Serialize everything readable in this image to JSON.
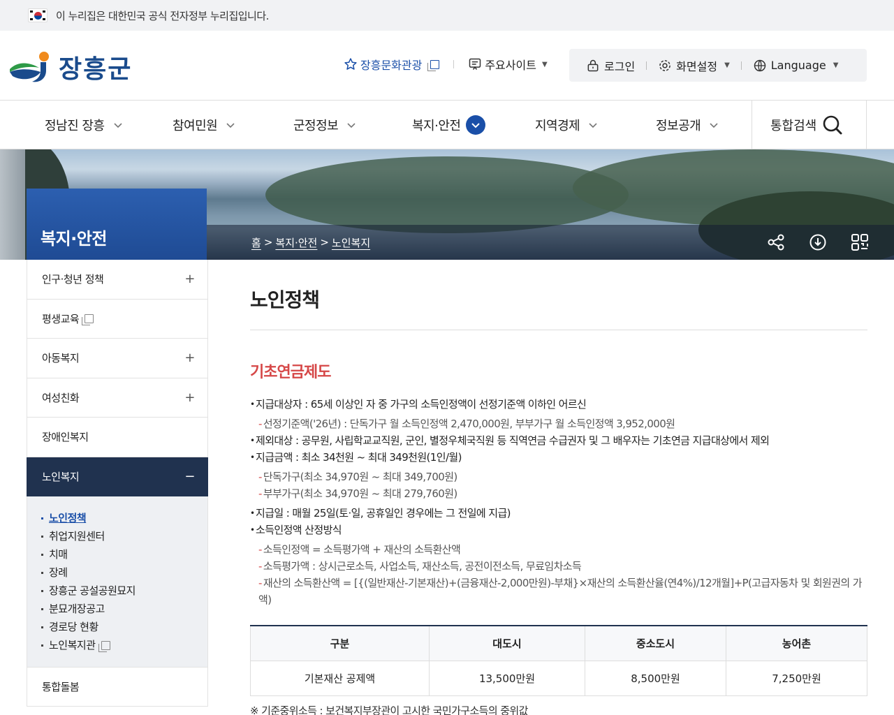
{
  "gov_banner": {
    "text": "이 누리집은 대한민국 공식 전자정부 누리집입니다."
  },
  "header": {
    "logo_text": "장흥군",
    "util_left": [
      {
        "label": "장흥문화관광",
        "icon": "star-icon"
      },
      {
        "label": "주요사이트",
        "icon": "site-icon"
      }
    ],
    "login": "로그인",
    "screen_settings": "화면설정",
    "language": "Language"
  },
  "gnb": {
    "items": [
      "정남진 장흥",
      "참여민원",
      "군정정보",
      "복지·안전",
      "지역경제",
      "정보공개"
    ],
    "active_index": 3,
    "search_label": "통합검색",
    "accent_color": "#1a4fa8"
  },
  "visual": {
    "section_title": "복지·안전",
    "breadcrumb": [
      "홈",
      "복지·안전",
      "노인복지"
    ]
  },
  "lnb": {
    "items_top": [
      {
        "label": "인구·청년 정책",
        "toggle": "+"
      },
      {
        "label": "평생교육",
        "external": true
      },
      {
        "label": "아동복지",
        "toggle": "+"
      },
      {
        "label": "여성친화",
        "toggle": "+"
      },
      {
        "label": "장애인복지"
      }
    ],
    "active": {
      "label": "노인복지",
      "toggle": "−"
    },
    "sub": [
      "노인정책",
      "취업지원센터",
      "치매",
      "장례",
      "장흥군 공설공원묘지",
      "분묘개장공고",
      "경로당 현황",
      "노인복지관"
    ],
    "items_bottom": [
      {
        "label": "통합돌봄"
      }
    ]
  },
  "content": {
    "page_title": "노인정책",
    "section_title": "기초연금제도",
    "l1": "지급대상자 : 65세 이상인 자 중 가구의 소득인정액이 선정기준액 이하인 어르신",
    "l1a": "선정기준액('26년) : 단독가구 월 소득인정액 2,470,000원, 부부가구 월 소득인정액 3,952,000원",
    "l2": "제외대상 : 공무원, 사립학교교직원, 군인, 별정우체국직원 등 직역연금 수급권자 및 그 배우자는 기초연금 지급대상에서 제외",
    "l3": "지급금액 : 최소 34천원 ~ 최대 349천원(1인/월)",
    "l3a": "단독가구(최소 34,970원 ~ 최대 349,700원)",
    "l3b": "부부가구(최소 34,970원 ~ 최대 279,760원)",
    "l4": "지급일 : 매월 25일(토·일, 공휴일인 경우에는 그 전일에 지급)",
    "l5": "소득인정액 산정방식",
    "l5a": "소득인정액 = 소득평가액 + 재산의 소득환산액",
    "l5b": "소득평가액 : 상시근로소득, 사업소득, 재산소득, 공전이전소득, 무료임차소득",
    "l5c": "재산의 소득환산액 = [{(일반재산-기본재산)+(금융재산-2,000만원)-부채}×재산의 소득환산율(연4%)/12개월]+P(고급자동차 및 회원권의 가액)",
    "table": {
      "headers": [
        "구분",
        "대도시",
        "중소도시",
        "농어촌"
      ],
      "rows": [
        [
          "기본재산 공제액",
          "13,500만원",
          "8,500만원",
          "7,250만원"
        ]
      ]
    },
    "note": "※ 기준중위소득 : 보건복지부장관이 고시한 국민가구소득의 중위값"
  }
}
